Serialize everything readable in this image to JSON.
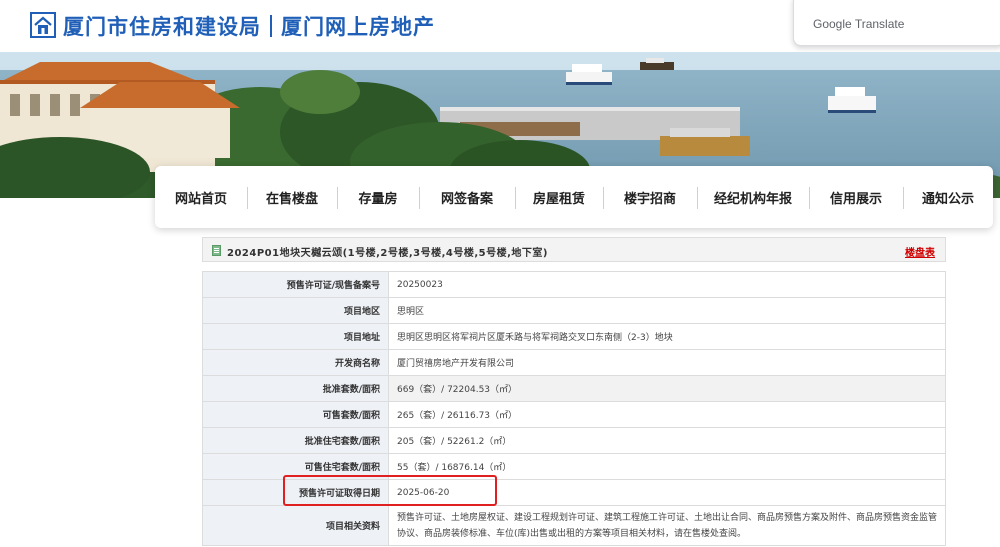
{
  "header": {
    "title_bureau": "厦门市住房和建设局",
    "title_portal": "厦门网上房地产"
  },
  "translate_popup": {
    "label": "Google Translate"
  },
  "nav": {
    "items": [
      {
        "label": "网站首页"
      },
      {
        "label": "在售楼盘"
      },
      {
        "label": "存量房"
      },
      {
        "label": "网签备案"
      },
      {
        "label": "房屋租赁"
      },
      {
        "label": "楼宇招商"
      },
      {
        "label": "经纪机构年报"
      },
      {
        "label": "信用展示"
      },
      {
        "label": "通知公示"
      }
    ]
  },
  "project": {
    "name": "2024P01地块天樾云颂(1号楼,2号楼,3号楼,4号楼,5号楼,地下室)",
    "link": "楼盘表"
  },
  "info": {
    "rows": [
      {
        "label": "预售许可证/现售备案号",
        "value": "20250023"
      },
      {
        "label": "项目地区",
        "value": "思明区"
      },
      {
        "label": "项目地址",
        "value": "思明区思明区将军祠片区厦禾路与将军祠路交叉口东南侧（2-3）地块"
      },
      {
        "label": "开发商名称",
        "value": "厦门贸禧房地产开发有限公司"
      },
      {
        "label": "批准套数/面积",
        "value": "669（套）/ 72204.53（㎡）"
      },
      {
        "label": "可售套数/面积",
        "value": "265（套）/ 26116.73（㎡）"
      },
      {
        "label": "批准住宅套数/面积",
        "value": "205（套）/ 52261.2（㎡）"
      },
      {
        "label": "可售住宅套数/面积",
        "value": "55（套）/ 16876.14（㎡）"
      },
      {
        "label": "预售许可证取得日期",
        "value": "2025-06-20"
      },
      {
        "label": "项目相关资料",
        "value": "预售许可证、土地房屋权证、建设工程规划许可证、建筑工程施工许可证、土地出让合同、商品房预售方案及附件、商品房预售资金监管协议、商品房装修标准、车位(库)出售或出租的方案等项目相关材料，请在售楼处查阅。"
      }
    ]
  },
  "colors": {
    "brand_blue": "#1f5fb8",
    "link_red": "#d00000",
    "highlight_red": "#e02020",
    "label_bg": "#eef1f6"
  }
}
